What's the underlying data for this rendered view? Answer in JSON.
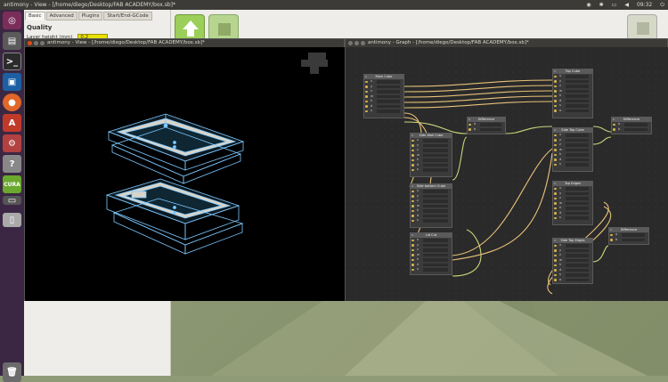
{
  "topbar": {
    "title": "antimony - View - [/home/diego/Desktop/FAB ACADEMY/box.sb]*",
    "clock": "09:32"
  },
  "slicer": {
    "tabs": [
      "Basic",
      "Advanced",
      "Plugins",
      "Start/End-GCode"
    ],
    "quality_label": "Quality",
    "layer_height_label": "Layer height (mm)",
    "layer_height_value": "0.2"
  },
  "view_window": {
    "title": "antimony - View - [/home/diego/Desktop/FAB ACADEMY/box.sb]*"
  },
  "graph_window": {
    "title": "antimony - Graph - [/home/diego/Desktop/FAB ACADEMY/box.sb]*"
  },
  "nodes": {
    "main_cube": "Main Cube",
    "top_cube": "Top Cube",
    "difference_a": "Difference",
    "difference_b": "Difference",
    "difference_c": "Difference",
    "side_wall": "Side Wall Cube",
    "side_top": "Side Top Cube",
    "side_bottom": "Side bottom Cube",
    "top_edges": "Top Edges",
    "lid_cut": "Lid Cut",
    "side_top_edges": "Side Top Edges"
  },
  "colors": {
    "wire": "#e8c27a",
    "wire_green": "#c9d67a",
    "pin": "#d9b34a",
    "model_edge": "#7ec8ff",
    "model_fill": "#d8d4c8",
    "cura_green": "#8fc44a"
  }
}
